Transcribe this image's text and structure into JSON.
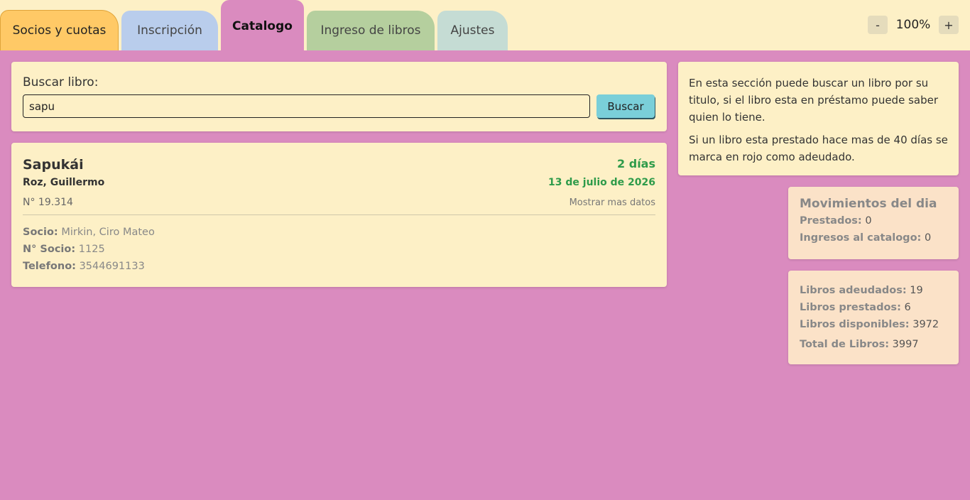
{
  "tabs": [
    {
      "label": "Socios y cuotas"
    },
    {
      "label": "Inscripción"
    },
    {
      "label": "Catalogo"
    },
    {
      "label": "Ingreso de libros"
    },
    {
      "label": "Ajustes"
    }
  ],
  "zoom": {
    "minus": "-",
    "value": "100%",
    "plus": "+"
  },
  "search": {
    "label": "Buscar libro:",
    "value": "sapu",
    "button": "Buscar"
  },
  "book": {
    "title": "Sapukái",
    "days": "2 días",
    "author": "Roz, Guillermo",
    "date": "13 de julio de 2026",
    "number": "N° 19.314",
    "more": "Mostrar mas datos",
    "socio_label": "Socio:",
    "socio": "Mirkin, Ciro Mateo",
    "nsocio_label": "N° Socio:",
    "nsocio": "1125",
    "tel_label": "Telefono:",
    "tel": "3544691133"
  },
  "info": {
    "p1": "En esta sección puede buscar un libro por su titulo, si el libro esta en préstamo puede saber quien lo tiene.",
    "p2": "Si un libro esta prestado hace mas de 40 días se marca en rojo como adeudado."
  },
  "movimientos": {
    "title": "Movimientos del dia",
    "prestados_label": "Prestados:",
    "prestados": "0",
    "ingresos_label": "Ingresos al catalogo:",
    "ingresos": "0"
  },
  "stats": {
    "adeudados_label": "Libros adeudados:",
    "adeudados": "19",
    "prestados_label": "Libros prestados:",
    "prestados": "6",
    "disponibles_label": "Libros disponibles:",
    "disponibles": "3972",
    "total_label": "Total de Libros:",
    "total": "3997"
  },
  "colors": {
    "main_bg": "#da8bbf",
    "card_bg": "#fdf0c6",
    "accent_green": "#2e9b4a",
    "button": "#7acfd9"
  }
}
